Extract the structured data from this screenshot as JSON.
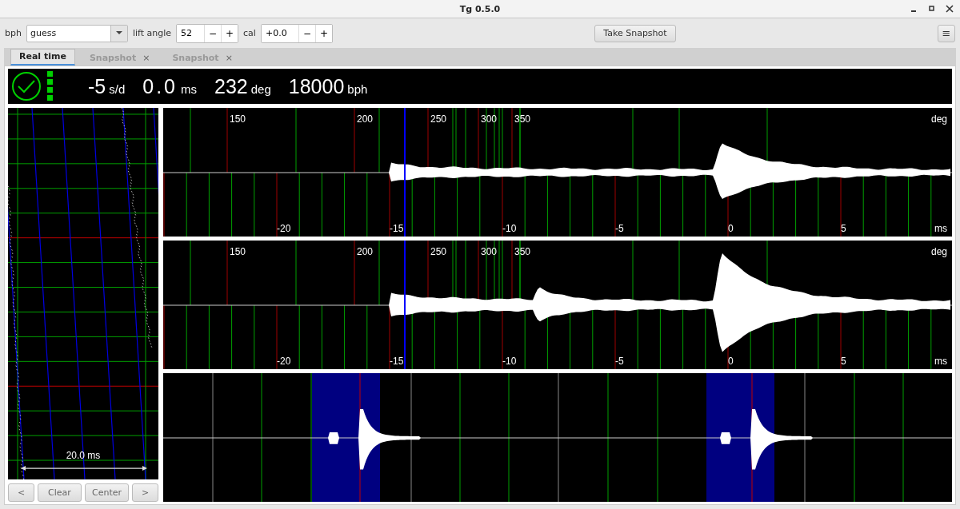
{
  "window": {
    "title": "Tg 0.5.0"
  },
  "toolbar": {
    "bph": {
      "label": "bph",
      "value": "guess"
    },
    "lift_angle": {
      "label": "lift angle",
      "value": "52",
      "minus": "−",
      "plus": "+"
    },
    "cal": {
      "label": "cal",
      "value": "+0.0",
      "minus": "−",
      "plus": "+"
    },
    "snapshot_button": "Take Snapshot",
    "menu_button": "≡"
  },
  "tabs": [
    {
      "label": "Real time",
      "selected": true
    },
    {
      "label": "Snapshot",
      "selected": false,
      "close": "×"
    },
    {
      "label": "Snapshot",
      "selected": false,
      "close": "×"
    }
  ],
  "status": {
    "rate": "-5",
    "rate_unit": "s/d",
    "beat_error": "0.0",
    "beat_error_unit": "ms",
    "amplitude": "232",
    "amplitude_unit": "deg",
    "bph": "18000",
    "bph_unit": "bph"
  },
  "waveforms": [
    {
      "deg_labels": [
        "150",
        "200",
        "250",
        "300",
        "350"
      ],
      "deg_unit": "deg",
      "ms_labels": [
        "-20",
        "-15",
        "-10",
        "-5",
        "0",
        "5"
      ],
      "ms_unit": "ms"
    },
    {
      "deg_labels": [
        "150",
        "200",
        "250",
        "300",
        "350"
      ],
      "deg_unit": "deg",
      "ms_labels": [
        "-20",
        "-15",
        "-10",
        "-5",
        "0",
        "5"
      ],
      "ms_unit": "ms"
    }
  ],
  "paperstrip": {
    "scale_label": "20.0 ms",
    "buttons": [
      "<",
      "Clear",
      "Center",
      ">"
    ]
  }
}
